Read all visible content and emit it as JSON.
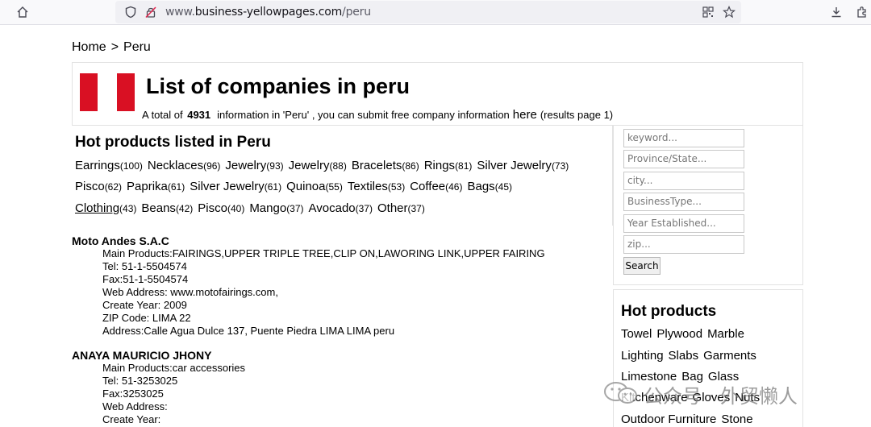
{
  "browser": {
    "url_prefix": "www.",
    "url_domain": "business-yellowpages.com",
    "url_path": "/peru"
  },
  "breadcrumb": {
    "home": "Home",
    "separator": ">",
    "current": "Peru"
  },
  "header": {
    "title": "List of companies in peru",
    "summary_prefix": "A total of",
    "total": "4931",
    "summary_middle": "information in 'Peru' , you can submit free company information",
    "here_link": "here",
    "summary_suffix": "(results page 1)",
    "flag_color": "#d91023"
  },
  "hot_listed": {
    "title": "Hot products listed in Peru",
    "rows": [
      [
        {
          "name": "Earrings",
          "count": "(100)"
        },
        {
          "name": "Necklaces",
          "count": "(96)"
        },
        {
          "name": "Jewelry",
          "count": "(93)"
        },
        {
          "name": "Jewelry",
          "count": "(88)"
        },
        {
          "name": "Bracelets",
          "count": "(86)"
        },
        {
          "name": "Rings",
          "count": "(81)"
        },
        {
          "name": "Silver Jewelry",
          "count": "(73)"
        }
      ],
      [
        {
          "name": "Pisco",
          "count": "(62)"
        },
        {
          "name": "Paprika",
          "count": "(61)"
        },
        {
          "name": "Silver Jewelry",
          "count": "(61)"
        },
        {
          "name": "Quinoa",
          "count": "(55)"
        },
        {
          "name": "Textiles",
          "count": "(53)"
        },
        {
          "name": "Coffee",
          "count": "(46)"
        },
        {
          "name": "Bags",
          "count": "(45)"
        }
      ],
      [
        {
          "name": "Clothing",
          "count": "(43)"
        },
        {
          "name": "Beans",
          "count": "(42)"
        },
        {
          "name": "Pisco",
          "count": "(40)"
        },
        {
          "name": "Mango",
          "count": "(37)"
        },
        {
          "name": "Avocado",
          "count": "(37)"
        },
        {
          "name": "Other",
          "count": "(37)"
        }
      ]
    ]
  },
  "companies": [
    {
      "name": "Moto Andes S.A.C",
      "lines": [
        "Main Products:FAIRINGS,UPPER TRIPLE TREE,CLIP ON,LAWORING LINK,UPPER FAIRING",
        "Tel: 51-1-5504574",
        "Fax:51-1-5504574",
        "Web Address: www.motofairings.com,",
        "Create Year: 2009",
        "ZIP Code: LIMA 22",
        "Address:Calle Agua Dulce 137, Puente Piedra LIMA LIMA peru"
      ]
    },
    {
      "name": "ANAYA MAURICIO JHONY",
      "lines": [
        "Main Products:car accessories",
        "Tel: 51-3253025",
        "Fax:3253025",
        "Web Address:",
        "Create Year:"
      ]
    }
  ],
  "search": {
    "keyword_placeholder": "keyword...",
    "province_placeholder": "Province/State...",
    "city_placeholder": "city...",
    "type_placeholder": "BusinessType...",
    "year_placeholder": "Year Established...",
    "zip_placeholder": "zip...",
    "button": "Search"
  },
  "hot_products": {
    "title": "Hot products",
    "rows": [
      [
        "Towel",
        "Plywood",
        "Marble"
      ],
      [
        "Lighting",
        "Slabs",
        "Garments"
      ],
      [
        "Limestone",
        "Bag",
        "Glass"
      ],
      [
        "Kitchenware",
        "Gloves",
        "Nuts"
      ],
      [
        "Outdoor Furniture",
        "Stone"
      ]
    ]
  },
  "watermark": {
    "text": "公众号 · 外贸懒人"
  }
}
